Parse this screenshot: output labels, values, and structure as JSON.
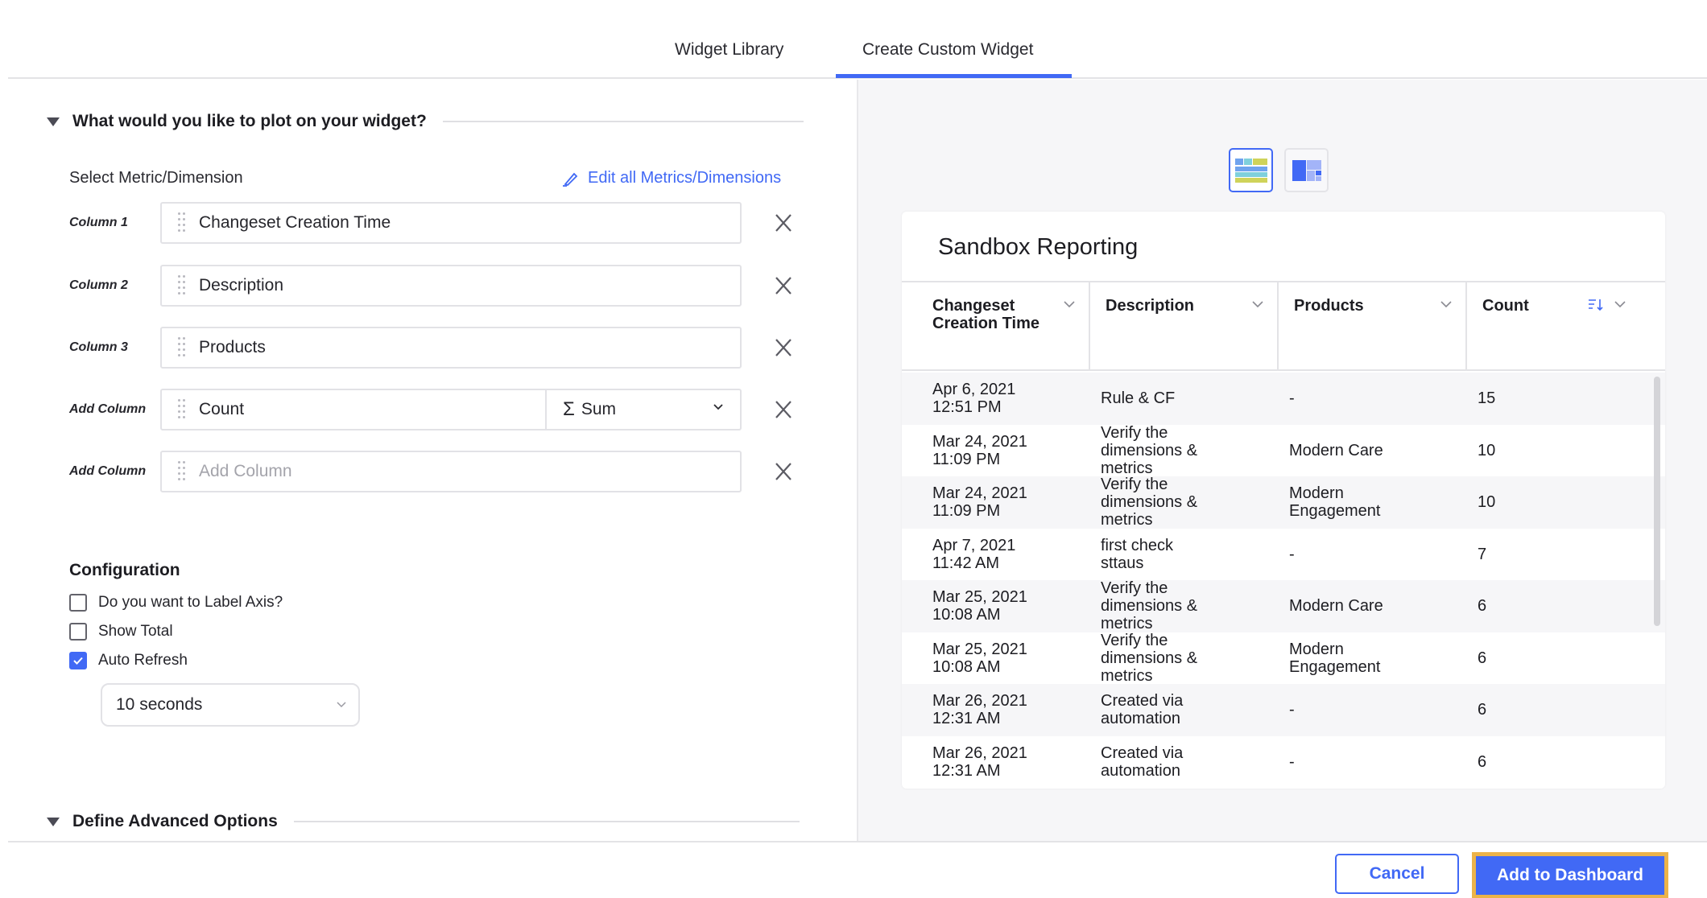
{
  "tabs": [
    {
      "label": "Widget Library",
      "active": false
    },
    {
      "label": "Create Custom Widget",
      "active": true
    }
  ],
  "plot_section": {
    "title": "What would you like to plot on your widget?",
    "select_label": "Select Metric/Dimension",
    "edit_link": "Edit all Metrics/Dimensions",
    "columns": [
      {
        "label": "Column 1",
        "value": "Changeset Creation Time",
        "placeholder": ""
      },
      {
        "label": "Column 2",
        "value": "Description",
        "placeholder": ""
      },
      {
        "label": "Column 3",
        "value": "Products",
        "placeholder": ""
      },
      {
        "label": "Add Column",
        "value": "Count",
        "placeholder": "",
        "aggregation": "Sum",
        "aggregation_symbol": "Σ"
      },
      {
        "label": "Add Column",
        "value": "",
        "placeholder": "Add Column"
      }
    ]
  },
  "configuration": {
    "title": "Configuration",
    "options": [
      {
        "label": "Do you want to Label Axis?",
        "checked": false
      },
      {
        "label": "Show Total",
        "checked": false
      },
      {
        "label": "Auto Refresh",
        "checked": true
      }
    ],
    "refresh_interval": "10 seconds"
  },
  "advanced_section": {
    "title": "Define Advanced Options"
  },
  "preview": {
    "viz_types": [
      {
        "name": "table",
        "active": true
      },
      {
        "name": "treemap",
        "active": false
      }
    ],
    "widget_title": "Sandbox Reporting",
    "table": {
      "headers": [
        "Changeset Creation Time",
        "Description",
        "Products",
        "Count"
      ],
      "sorted_column": "Count",
      "rows": [
        [
          "Apr 6, 2021 12:51 PM",
          "Rule & CF",
          "-",
          "15"
        ],
        [
          "Mar 24, 2021 11:09 PM",
          "Verify the dimensions & metrics",
          "Modern Care",
          "10"
        ],
        [
          "Mar 24, 2021 11:09 PM",
          "Verify the dimensions & metrics",
          "Modern Engagement",
          "10"
        ],
        [
          "Apr 7, 2021 11:42 AM",
          "first check sttaus",
          "-",
          "7"
        ],
        [
          "Mar 25, 2021 10:08 AM",
          "Verify the dimensions & metrics",
          "Modern Care",
          "6"
        ],
        [
          "Mar 25, 2021 10:08 AM",
          "Verify the dimensions & metrics",
          "Modern Engagement",
          "6"
        ],
        [
          "Mar 26, 2021 12:31 AM",
          "Created via automation",
          "-",
          "6"
        ],
        [
          "Mar 26, 2021 12:31 AM",
          "Created via automation",
          "-",
          "6"
        ]
      ]
    }
  },
  "footer": {
    "cancel_label": "Cancel",
    "add_label": "Add to Dashboard"
  },
  "colors": {
    "accent": "#4169f5",
    "focus_outline": "#ecb349",
    "panel_bg": "#f6f6f8"
  }
}
